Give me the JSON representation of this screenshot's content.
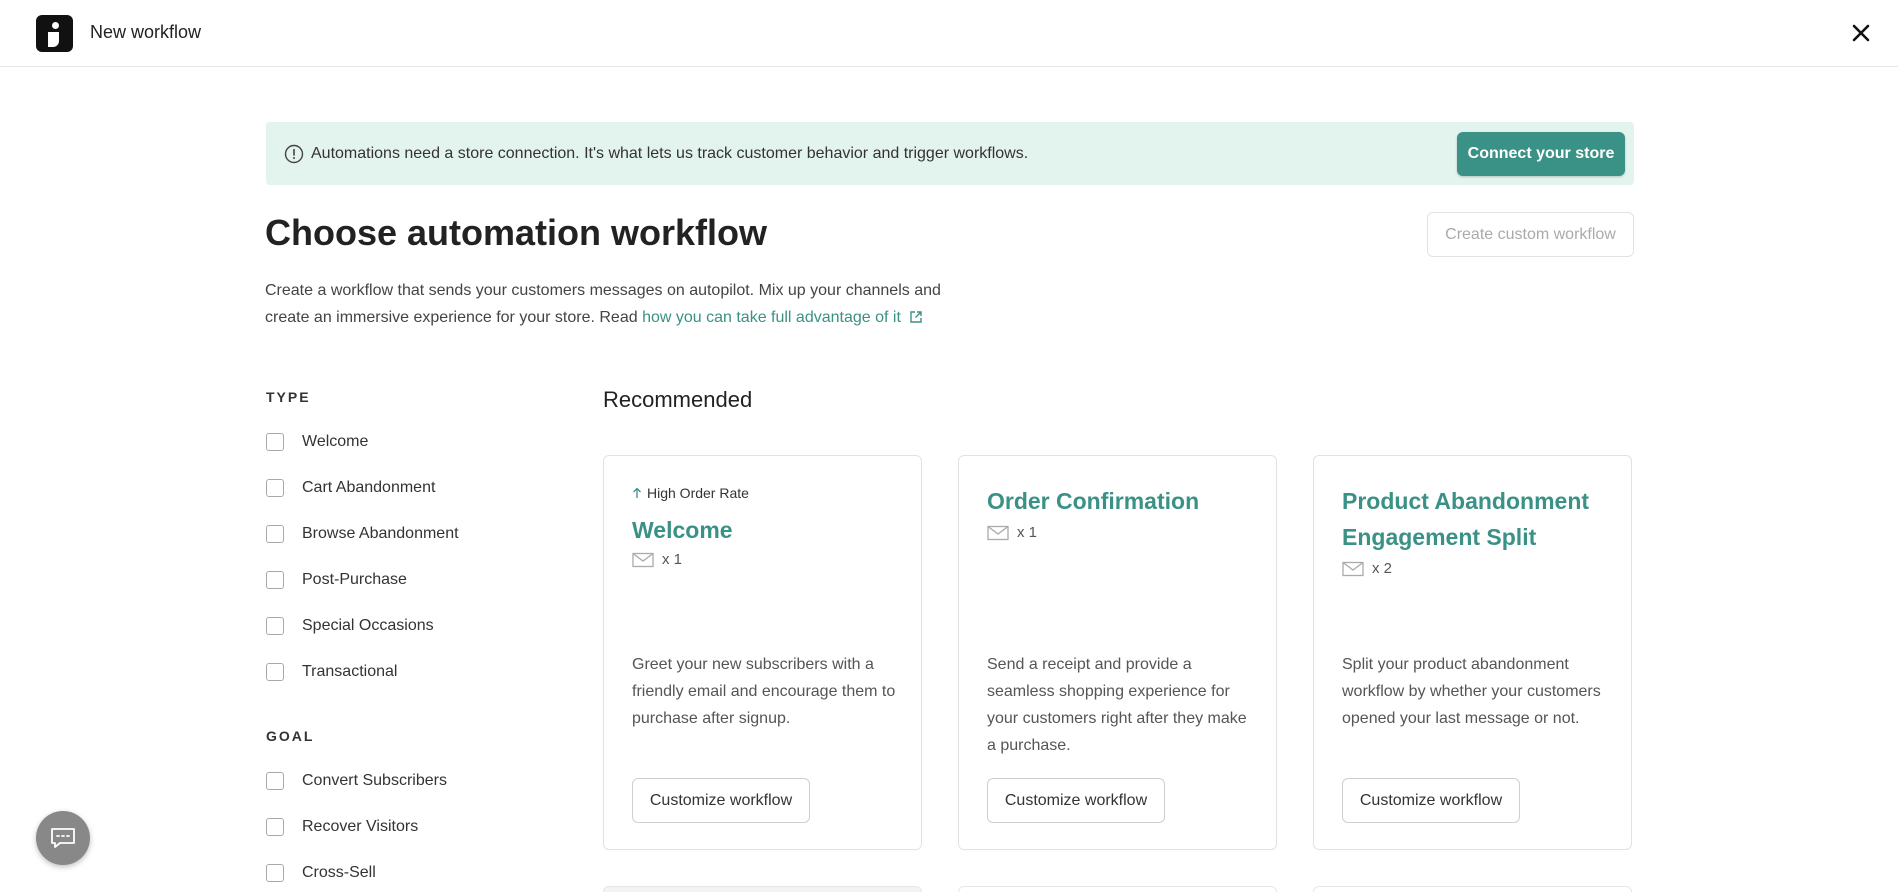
{
  "header": {
    "title": "New workflow"
  },
  "banner": {
    "message": "Automations need a store connection. It's what lets us track customer behavior and trigger workflows.",
    "connect_label": "Connect your store"
  },
  "main": {
    "heading": "Choose automation workflow",
    "custom_button_label": "Create custom workflow",
    "description_text": "Create a workflow that sends your customers messages on autopilot. Mix up your channels and create an immersive experience for your store. Read ",
    "description_link": "how you can take full advantage of it"
  },
  "filters": {
    "type_title": "TYPE",
    "type_items": [
      "Welcome",
      "Cart Abandonment",
      "Browse Abandonment",
      "Post-Purchase",
      "Special Occasions",
      "Transactional"
    ],
    "goal_title": "GOAL",
    "goal_items": [
      "Convert Subscribers",
      "Recover Visitors",
      "Cross-Sell"
    ]
  },
  "recommended": {
    "title": "Recommended",
    "cards": [
      {
        "tag": "High Order Rate",
        "title": "Welcome",
        "count": "x 1",
        "description": "Greet your new subscribers with a friendly email and encourage them to purchase after signup.",
        "button": "Customize workflow"
      },
      {
        "title": "Order Confirmation",
        "count": "x 1",
        "description": "Send a receipt and provide a seamless shopping experience for your customers right after they make a purchase.",
        "button": "Customize workflow"
      },
      {
        "title": "Product Abandonment Engagement Split",
        "count": "x 2",
        "description": "Split your product abandonment workflow by whether your customers opened your last message or not.",
        "button": "Customize workflow"
      }
    ]
  },
  "colors": {
    "accent": "#3a9186",
    "banner_bg": "#e3f3ed"
  }
}
